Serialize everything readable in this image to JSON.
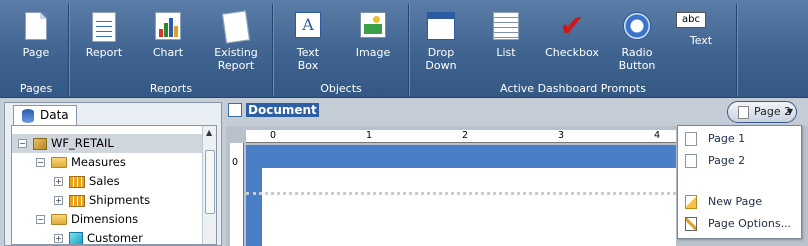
{
  "ribbon": {
    "groups": {
      "pages": "Pages",
      "reports": "Reports",
      "objects": "Objects",
      "prompts": "Active Dashboard Prompts"
    },
    "buttons": {
      "page": "Page",
      "report": "Report",
      "chart": "Chart",
      "existing_report_1": "Existing",
      "existing_report_2": "Report",
      "text_box_1": "Text",
      "text_box_2": "Box",
      "image": "Image",
      "drop_down_1": "Drop",
      "drop_down_2": "Down",
      "list": "List",
      "checkbox": "Checkbox",
      "radio_button_1": "Radio",
      "radio_button_2": "Button",
      "text": "Text",
      "text_icon_label": "abc",
      "text_box_icon_label": "A"
    }
  },
  "data_panel": {
    "tab_label": "Data",
    "tree": [
      {
        "label": "WF_RETAIL",
        "toggle": "−",
        "kind": "cube"
      },
      {
        "label": "Measures",
        "toggle": "−",
        "kind": "folder"
      },
      {
        "label": "Sales",
        "toggle": "+",
        "kind": "measure"
      },
      {
        "label": "Shipments",
        "toggle": "+",
        "kind": "measure"
      },
      {
        "label": "Dimensions",
        "toggle": "−",
        "kind": "folder"
      },
      {
        "label": "Customer",
        "toggle": "+",
        "kind": "dimension"
      }
    ]
  },
  "document": {
    "title": "Document",
    "page_selector": "Page 2",
    "ruler_marks": [
      "0",
      "1",
      "2",
      "3",
      "4"
    ],
    "vertical_ruler_mark": "0"
  },
  "page_menu": {
    "items": [
      "Page 1",
      "Page 2",
      "New Page",
      "Page Options..."
    ]
  },
  "colors": {
    "ribbon": "#3f648f",
    "selection": "#2e5ea4",
    "page_blue": "#4a7ec6"
  }
}
